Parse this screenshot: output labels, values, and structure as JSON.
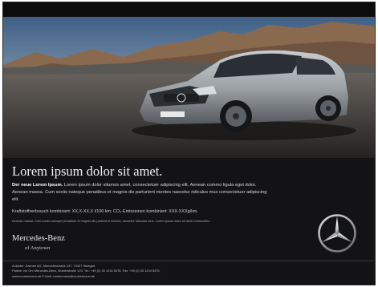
{
  "headline": "Lorem ipsum dolor sit amet.",
  "body": {
    "lead": "Der neue Lorem Ipsum.",
    "text": " Lorem ipsum dolor situmos amet, consectetuer adipiscing elit. Aenean commo ligula eget dolor. Aenean massa. Cum sociis natoque penatibus et magnis dis parturient montes nascetur ridiculus mus consectetuer adipiscing elit."
  },
  "consumption": "Kraftstoffverbrauch kombiniert: XX,X-XX,X l/100 km; CO₂-Emissionen kombiniert: XXX-XXXg/km.",
  "finenote": "Aenean massa. Cum sociis natoque penatibus et magnis dis parturient montes, nascetur ridiculus mus. Lorem ipsum dolor sit amet consectetur",
  "brand": {
    "name": "Mercedes-Benz",
    "dealer": "of Anytown",
    "logo_icon": "three-pointed-star-icon"
  },
  "footer": {
    "line1": "Anbieter: Daimler AG, Mercedesstraße 137, 70327 Stuttgart",
    "line2": "Partner vor Ort: Mercedes-Benz, Musterstraße 123, Tel.: +49 (0) 30 1234 5478, Fax: +49 (0) 30 1234 5476,",
    "line3": "www.mustermann.de E-Mail: mustermann@mustermann.de"
  },
  "colors": {
    "background": "#131315",
    "headline": "#f2f2f2",
    "car_silver": "#9ea3a8"
  }
}
